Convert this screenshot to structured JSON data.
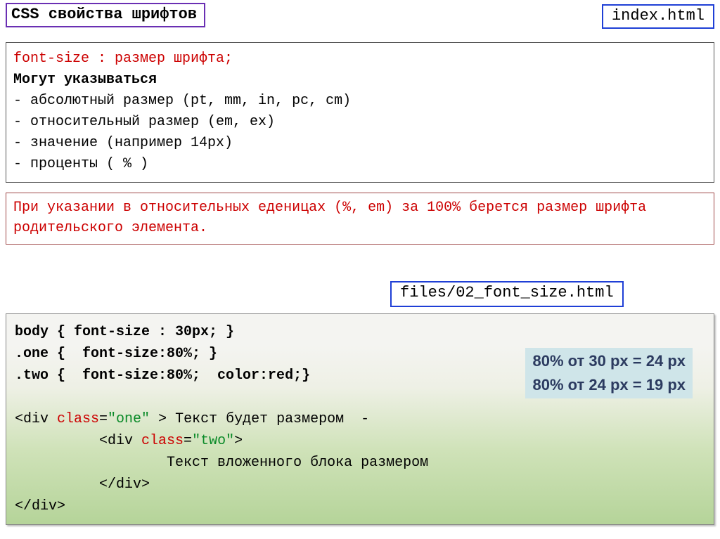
{
  "header": {
    "title": "CSS свойства шрифтов",
    "index_file": "index.html"
  },
  "block1": {
    "line1_prop": "font-size : размер  шрифта;",
    "line2": " Могут указываться",
    "bullet1": " -  абсолютный размер (pt, mm, in, pc, cm)",
    "bullet2": " -  относительный размер  (em, ex)",
    "bullet3": " -  значение (например  14px)",
    "bullet4": " -  проценты ( % )"
  },
  "block2": {
    "text": "При указании в относительных еденицах (%, em) за 100% берется размер шрифта родительского элемента."
  },
  "file_label": "files/02_font_size.html",
  "code": {
    "css1": "body { font-size : 30px; }",
    "css2": ".one {  font-size:80%; }",
    "css3": ".two {  font-size:80%;  color:red;}",
    "html_open_div": "<div ",
    "html_class_kw": "class",
    "html_eq": "=",
    "html_one_val": "\"one\"",
    "html_open_div_tail": " > Текст будет размером  -",
    "html_inner_indent": "          <div ",
    "html_two_val": "\"two\"",
    "html_inner_close": ">",
    "html_inner_text": "                  Текст вложенного блока размером",
    "html_close_inner": "          </div>",
    "html_close_outer": "</div>"
  },
  "calc": {
    "line1": "80% от 30 px = 24 px",
    "line2": "80% от 24 px =  19 px"
  }
}
